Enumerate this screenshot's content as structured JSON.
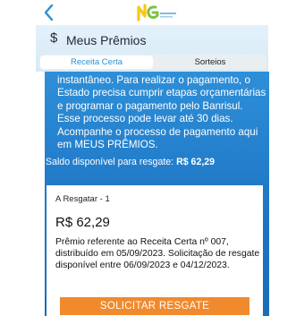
{
  "header": {
    "title": "Meus Prêmios",
    "icon": "dollar-icon",
    "icon_glyph": "$"
  },
  "navbar": {
    "back_icon": "chevron-left-icon",
    "logo": "nota-fiscal-gaucha-logo"
  },
  "tabs": [
    {
      "label": "Receita Certa",
      "active": true
    },
    {
      "label": "Sorteios",
      "active": false
    }
  ],
  "main": {
    "message": "instantâneo. Para realizar o pagamento, o Estado precisa cumprir etapas orçamentárias e programar o pagamento pelo Banrisul. Esse processo pode levar até 30 dias. Acompanhe o processo de pagamento aqui em MEUS PRÊMIOS.",
    "balance_label": "Saldo disponível para resgate:",
    "balance_value": "R$ 62,29"
  },
  "prize": {
    "label": "A Resgatar - 1",
    "value": "R$ 62,29",
    "description": "Prêmio referente ao Receita Certa nº 007, distribuído em 05/09/2023. Solicitação de resgate disponível entre 06/09/2023 e 04/12/2023.",
    "button_label": "SOLICITAR RESGATE"
  },
  "colors": {
    "accent_blue": "#2a8fd1",
    "content_blue": "#1d74c4",
    "button_orange": "#f08a2c",
    "logo_green": "#7dc242",
    "logo_yellow": "#f6c915"
  }
}
